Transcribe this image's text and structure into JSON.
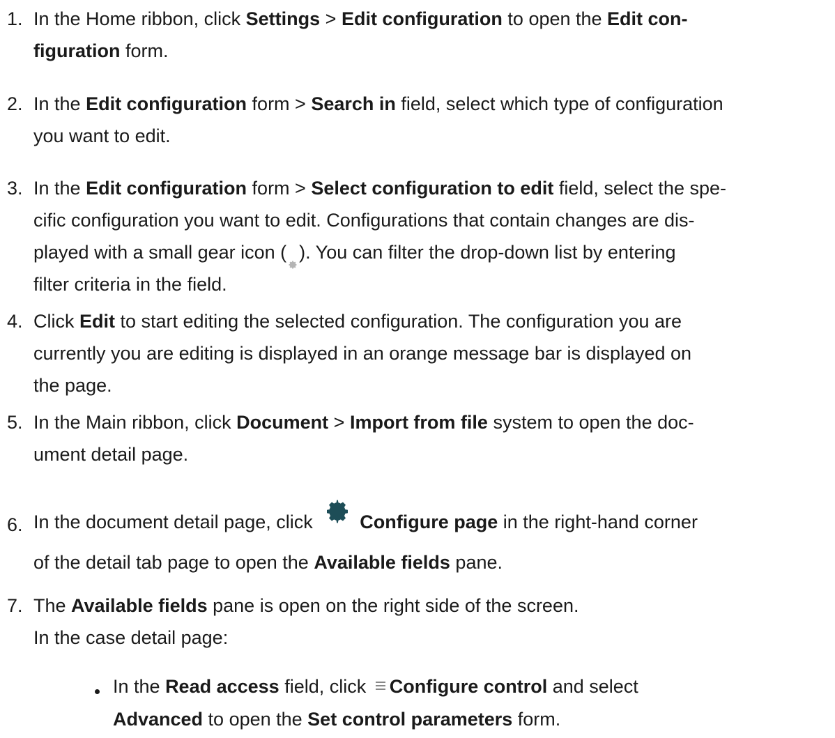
{
  "steps": [
    {
      "num": "1.",
      "parts": [
        "In the Home ribbon, click ",
        "Settings",
        " > ",
        "Edit configuration",
        " to open the ",
        "Edit con-",
        "figuration",
        " form."
      ]
    },
    {
      "num": "2.",
      "parts": [
        "In the ",
        "Edit configuration",
        " form > ",
        "Search in",
        " field, select which type of configuration",
        "you want to edit."
      ]
    },
    {
      "num": "3.",
      "parts": [
        "In the ",
        "Edit configuration",
        " form > ",
        "Select configuration to edit",
        " field, select the spe-",
        "cific configuration you want to edit. Configurations that contain changes are dis-",
        "played with a small gear icon (",
        "). You can filter the drop-down list by entering",
        "filter criteria in the field."
      ]
    },
    {
      "num": "4.",
      "parts": [
        "Click ",
        "Edit",
        " to start editing the selected configuration. The configuration you are",
        "currently you are editing is displayed in an orange message bar is displayed on",
        "the page."
      ]
    },
    {
      "num": "5.",
      "parts": [
        "In the Main ribbon, click ",
        "Document",
        " > ",
        "Import from file",
        " system to open the doc-",
        "ument detail page."
      ]
    },
    {
      "num": "6.",
      "parts": [
        "In the document detail page, click ",
        "Configure page",
        " in the right-hand corner",
        "of the detail tab page to open the ",
        "Available fields",
        " pane."
      ]
    },
    {
      "num": "7.",
      "parts": [
        "The ",
        "Available fields",
        " pane is open on the right side of the screen.",
        "In the case detail page:"
      ]
    }
  ],
  "bullet": {
    "parts": [
      "In the ",
      "Read access",
      " field, click ",
      "Configure control",
      " and select",
      "Advanced",
      " to open the ",
      "Set control parameters",
      " form."
    ]
  },
  "icons": {
    "small_gear": "gear-icon",
    "large_gear": "gear-icon",
    "menu": "menu-icon",
    "large_gear_color": "#1d4d57",
    "small_gear_color": "#b5b5b5"
  }
}
